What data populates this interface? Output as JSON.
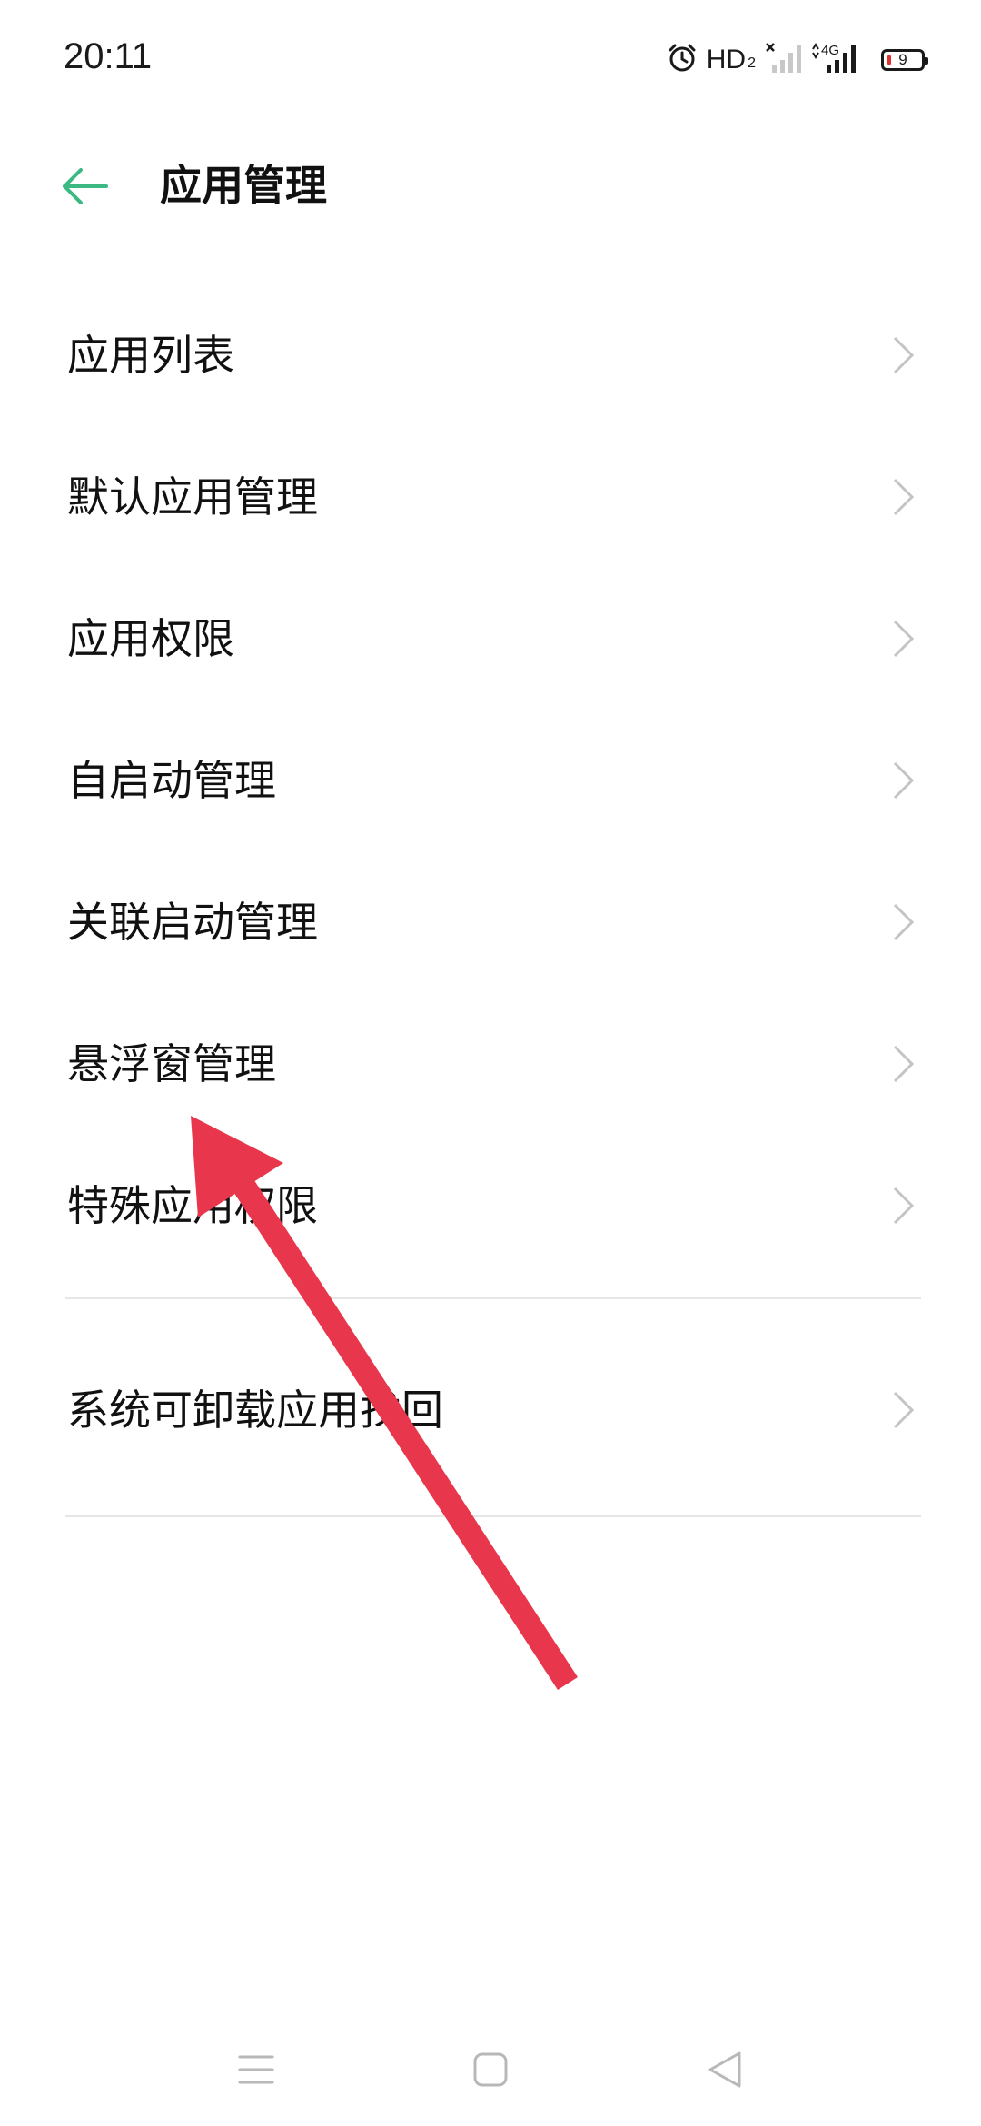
{
  "status_bar": {
    "time": "20:11",
    "hd_label": "HD",
    "hd_sub": "2",
    "network_label": "4G",
    "battery_level": "9"
  },
  "header": {
    "title": "应用管理",
    "back_icon": "arrow-left-icon",
    "accent_color": "#3cb882"
  },
  "menu": {
    "items": [
      {
        "label": "应用列表"
      },
      {
        "label": "默认应用管理"
      },
      {
        "label": "应用权限"
      },
      {
        "label": "自启动管理"
      },
      {
        "label": "关联启动管理"
      },
      {
        "label": "悬浮窗管理"
      },
      {
        "label": "特殊应用权限"
      },
      {
        "label": "系统可卸载应用找回"
      }
    ]
  },
  "annotation": {
    "color": "#e8374c",
    "points_to": "悬浮窗管理"
  },
  "nav_bar": {
    "icons": [
      "menu-icon",
      "home-icon",
      "back-triangle-icon"
    ]
  }
}
